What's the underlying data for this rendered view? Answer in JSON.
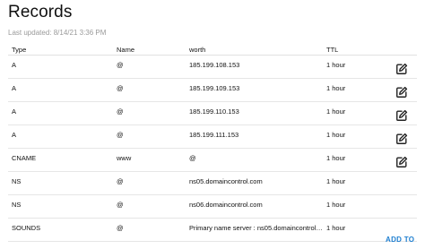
{
  "header": {
    "title": "Records",
    "last_updated": "Last updated: 8/14/21 3:36 PM"
  },
  "table": {
    "columns": {
      "type": "Type",
      "name": "Name",
      "worth": "worth",
      "ttl": "TTL"
    },
    "rows": [
      {
        "type": "A",
        "name": "@",
        "worth": "185.199.108.153",
        "ttl": "1 hour",
        "editable": true
      },
      {
        "type": "A",
        "name": "@",
        "worth": "185.199.109.153",
        "ttl": "1 hour",
        "editable": true
      },
      {
        "type": "A",
        "name": "@",
        "worth": "185.199.110.153",
        "ttl": "1 hour",
        "editable": true
      },
      {
        "type": "A",
        "name": "@",
        "worth": "185.199.111.153",
        "ttl": "1 hour",
        "editable": true
      },
      {
        "type": "CNAME",
        "name": "www",
        "worth": "@",
        "ttl": "1 hour",
        "editable": true
      },
      {
        "type": "NS",
        "name": "@",
        "worth": "ns05.domaincontrol.com",
        "ttl": "1 hour",
        "editable": false
      },
      {
        "type": "NS",
        "name": "@",
        "worth": "ns06.domaincontrol.com",
        "ttl": "1 hour",
        "editable": false
      },
      {
        "type": "SOUNDS",
        "name": "@",
        "worth": "Primary name server : ns05.domaincontrol.co...",
        "ttl": "1 hour",
        "editable": false
      }
    ]
  },
  "actions": {
    "add_to": "ADD TO"
  },
  "colors": {
    "accent": "#1f7fd0",
    "muted": "#9a9a9a",
    "divider": "#e6e6e6"
  },
  "icons": {
    "edit": "edit-pencil-square-icon"
  }
}
